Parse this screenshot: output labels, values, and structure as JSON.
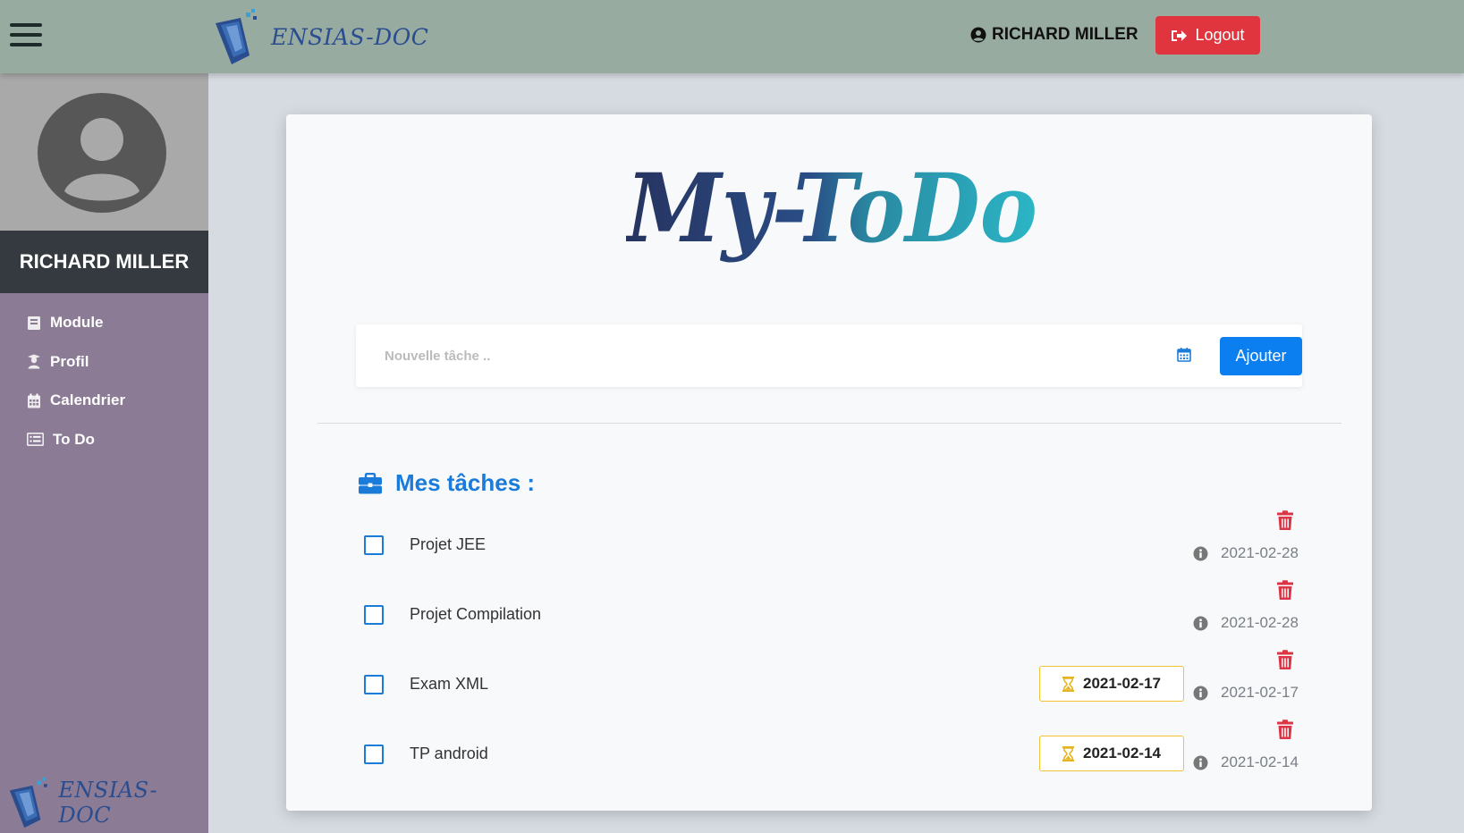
{
  "header": {
    "brand": "ENSIAS-DOC",
    "user_name": "RICHARD MILLER",
    "logout_label": "Logout"
  },
  "sidebar": {
    "user_name": "RICHARD MILLER",
    "items": [
      {
        "label": "Module",
        "icon": "book-icon"
      },
      {
        "label": "Profil",
        "icon": "user-graduate-icon"
      },
      {
        "label": "Calendrier",
        "icon": "calendar-icon"
      },
      {
        "label": "To Do",
        "icon": "list-icon"
      }
    ],
    "brand": "ENSIAS-DOC"
  },
  "main": {
    "logo_title": "My-ToDo",
    "new_task_placeholder": "Nouvelle tâche ..",
    "add_label": "Ajouter",
    "tasks_heading": "Mes tâches :",
    "tasks": [
      {
        "title": "Projet JEE",
        "date": "2021-02-28",
        "deadline": null
      },
      {
        "title": "Projet Compilation",
        "date": "2021-02-28",
        "deadline": null
      },
      {
        "title": "Exam XML",
        "date": "2021-02-17",
        "deadline": "2021-02-17"
      },
      {
        "title": "TP android",
        "date": "2021-02-14",
        "deadline": "2021-02-14"
      }
    ]
  },
  "colors": {
    "topbar": "#97aba1",
    "sidebar": "#8b7b95",
    "accent_blue": "#0b7ef0",
    "logout_red": "#e0353f",
    "trash_red": "#dc3545",
    "deadline_yellow": "#f0c234"
  }
}
